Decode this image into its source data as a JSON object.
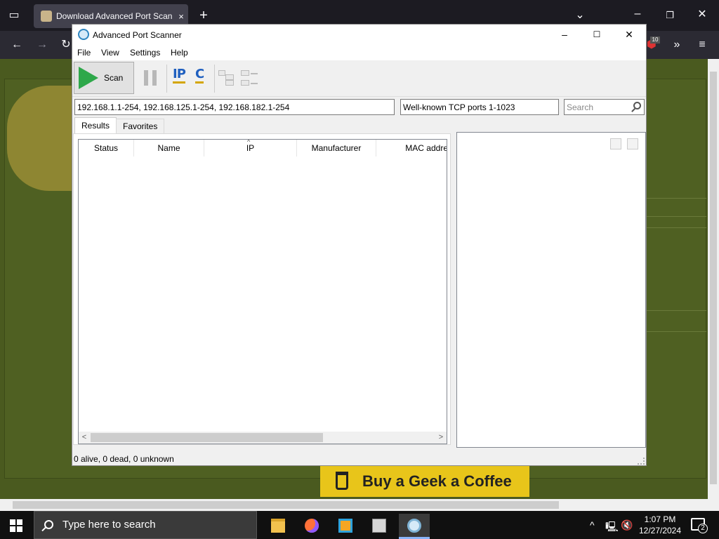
{
  "browser": {
    "tab_title": "Download Advanced Port Scan",
    "tab_close": "×",
    "new_tab": "+",
    "ublock_count": "10"
  },
  "webpage": {
    "banner": "Buy a Geek a Coffee"
  },
  "app": {
    "title": "Advanced Port Scanner",
    "menu": [
      "File",
      "View",
      "Settings",
      "Help"
    ],
    "toolbar": {
      "scan_label": "Scan",
      "ip_glyph": "IP",
      "c_glyph": "C"
    },
    "ip_range": "192.168.1.1-254, 192.168.125.1-254, 192.168.182.1-254",
    "ports": "Well-known TCP ports 1-1023",
    "search_placeholder": "Search",
    "tabs": [
      "Results",
      "Favorites"
    ],
    "columns": [
      "Status",
      "Name",
      "IP",
      "Manufacturer",
      "MAC addre"
    ],
    "status": "0 alive, 0 dead, 0 unknown"
  },
  "taskbar": {
    "search_placeholder": "Type here to search",
    "time": "1:07 PM",
    "date": "12/27/2024",
    "notifications": "2"
  },
  "colors": {
    "scan_accent": "#2ea84a",
    "taskbar": "#101010",
    "banner": "#e8c51a"
  },
  "icons": [
    "tab-list-icon",
    "back-icon",
    "forward-icon",
    "reload-icon",
    "chevron-down-icon",
    "minimize-icon",
    "maximize-icon",
    "close-icon",
    "play-icon",
    "pause-icon",
    "ip-icon",
    "c-icon",
    "tree-expand-icon",
    "tree-collapse-icon",
    "search-icon",
    "print-icon",
    "save-icon",
    "windows-start-icon",
    "file-explorer-icon",
    "firefox-icon",
    "virtualbox-icon",
    "network-icon",
    "port-scanner-icon",
    "volume-muted-icon",
    "notification-icon"
  ]
}
